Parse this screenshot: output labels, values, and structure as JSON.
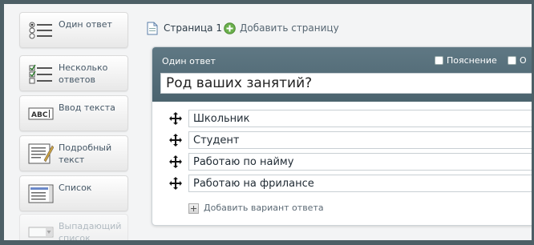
{
  "sidebar": {
    "items": [
      {
        "label": "Один ответ",
        "icon": "radio-list-icon"
      },
      {
        "label": "Несколько ответов",
        "icon": "checkbox-list-icon"
      },
      {
        "label": "Ввод текста",
        "icon": "text-input-icon"
      },
      {
        "label": "Подробный текст",
        "icon": "textarea-icon"
      },
      {
        "label": "Список",
        "icon": "listbox-icon"
      },
      {
        "label": "Выпадающий список",
        "icon": "dropdown-icon"
      }
    ]
  },
  "header": {
    "page_label": "Страница 1",
    "add_page_label": "Добавить страницу"
  },
  "question": {
    "type_label": "Один ответ",
    "option_explanation": "Пояснение",
    "option_partial": "О",
    "title": "Род ваших занятий?",
    "answers": [
      "Школьник",
      "Студент",
      "Работаю по найму",
      "Работаю на фрилансе"
    ],
    "add_answer_label": "Добавить вариант ответа"
  },
  "colors": {
    "header_bg": "#55707c",
    "frame": "#4d5f66",
    "add_icon": "#6ab04c"
  }
}
